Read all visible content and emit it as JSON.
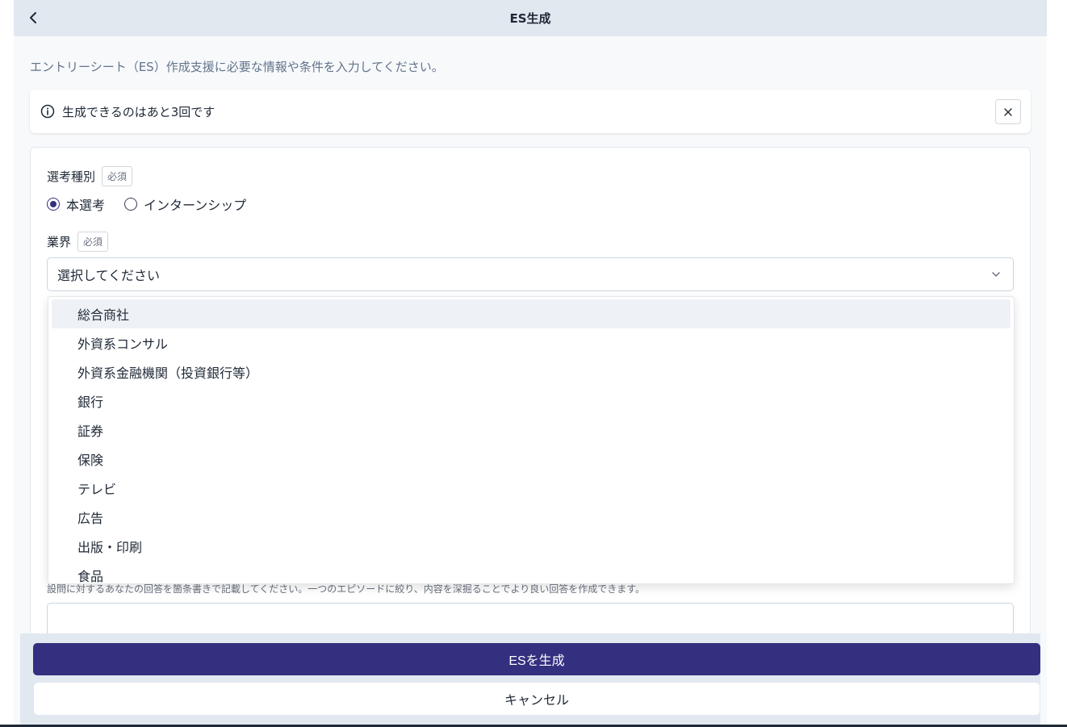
{
  "header": {
    "title": "ES生成",
    "back_icon": "chevron-left-icon"
  },
  "intro": "エントリーシート（ES）作成支援に必要な情報や条件を入力してください。",
  "alert": {
    "icon": "info-icon",
    "text": "生成できるのはあと3回です",
    "close_icon": "close-icon"
  },
  "form": {
    "selection_type": {
      "label": "選考種別",
      "required_badge": "必須",
      "options": [
        {
          "label": "本選考",
          "checked": true
        },
        {
          "label": "インターンシップ",
          "checked": false
        }
      ]
    },
    "industry": {
      "label": "業界",
      "required_badge": "必須",
      "placeholder": "選択してください",
      "chevron_icon": "chevron-down-icon"
    },
    "answer_hint": "設問に対するあなたの回答を箇条書きで記載してください。一つのエピソードに絞り、内容を深掘ることでより良い回答を作成できます。"
  },
  "dropdown": {
    "highlighted_index": 0,
    "options": [
      "総合商社",
      "外資系コンサル",
      "外資系金融機関（投資銀行等）",
      "銀行",
      "証券",
      "保険",
      "テレビ",
      "広告",
      "出版・印刷",
      "食品"
    ]
  },
  "footer": {
    "primary_label": "ESを生成",
    "secondary_label": "キャンセル"
  },
  "colors": {
    "primary": "#33307f",
    "header_bg": "#e2e8f0",
    "page_bg": "#f7f9fb"
  }
}
